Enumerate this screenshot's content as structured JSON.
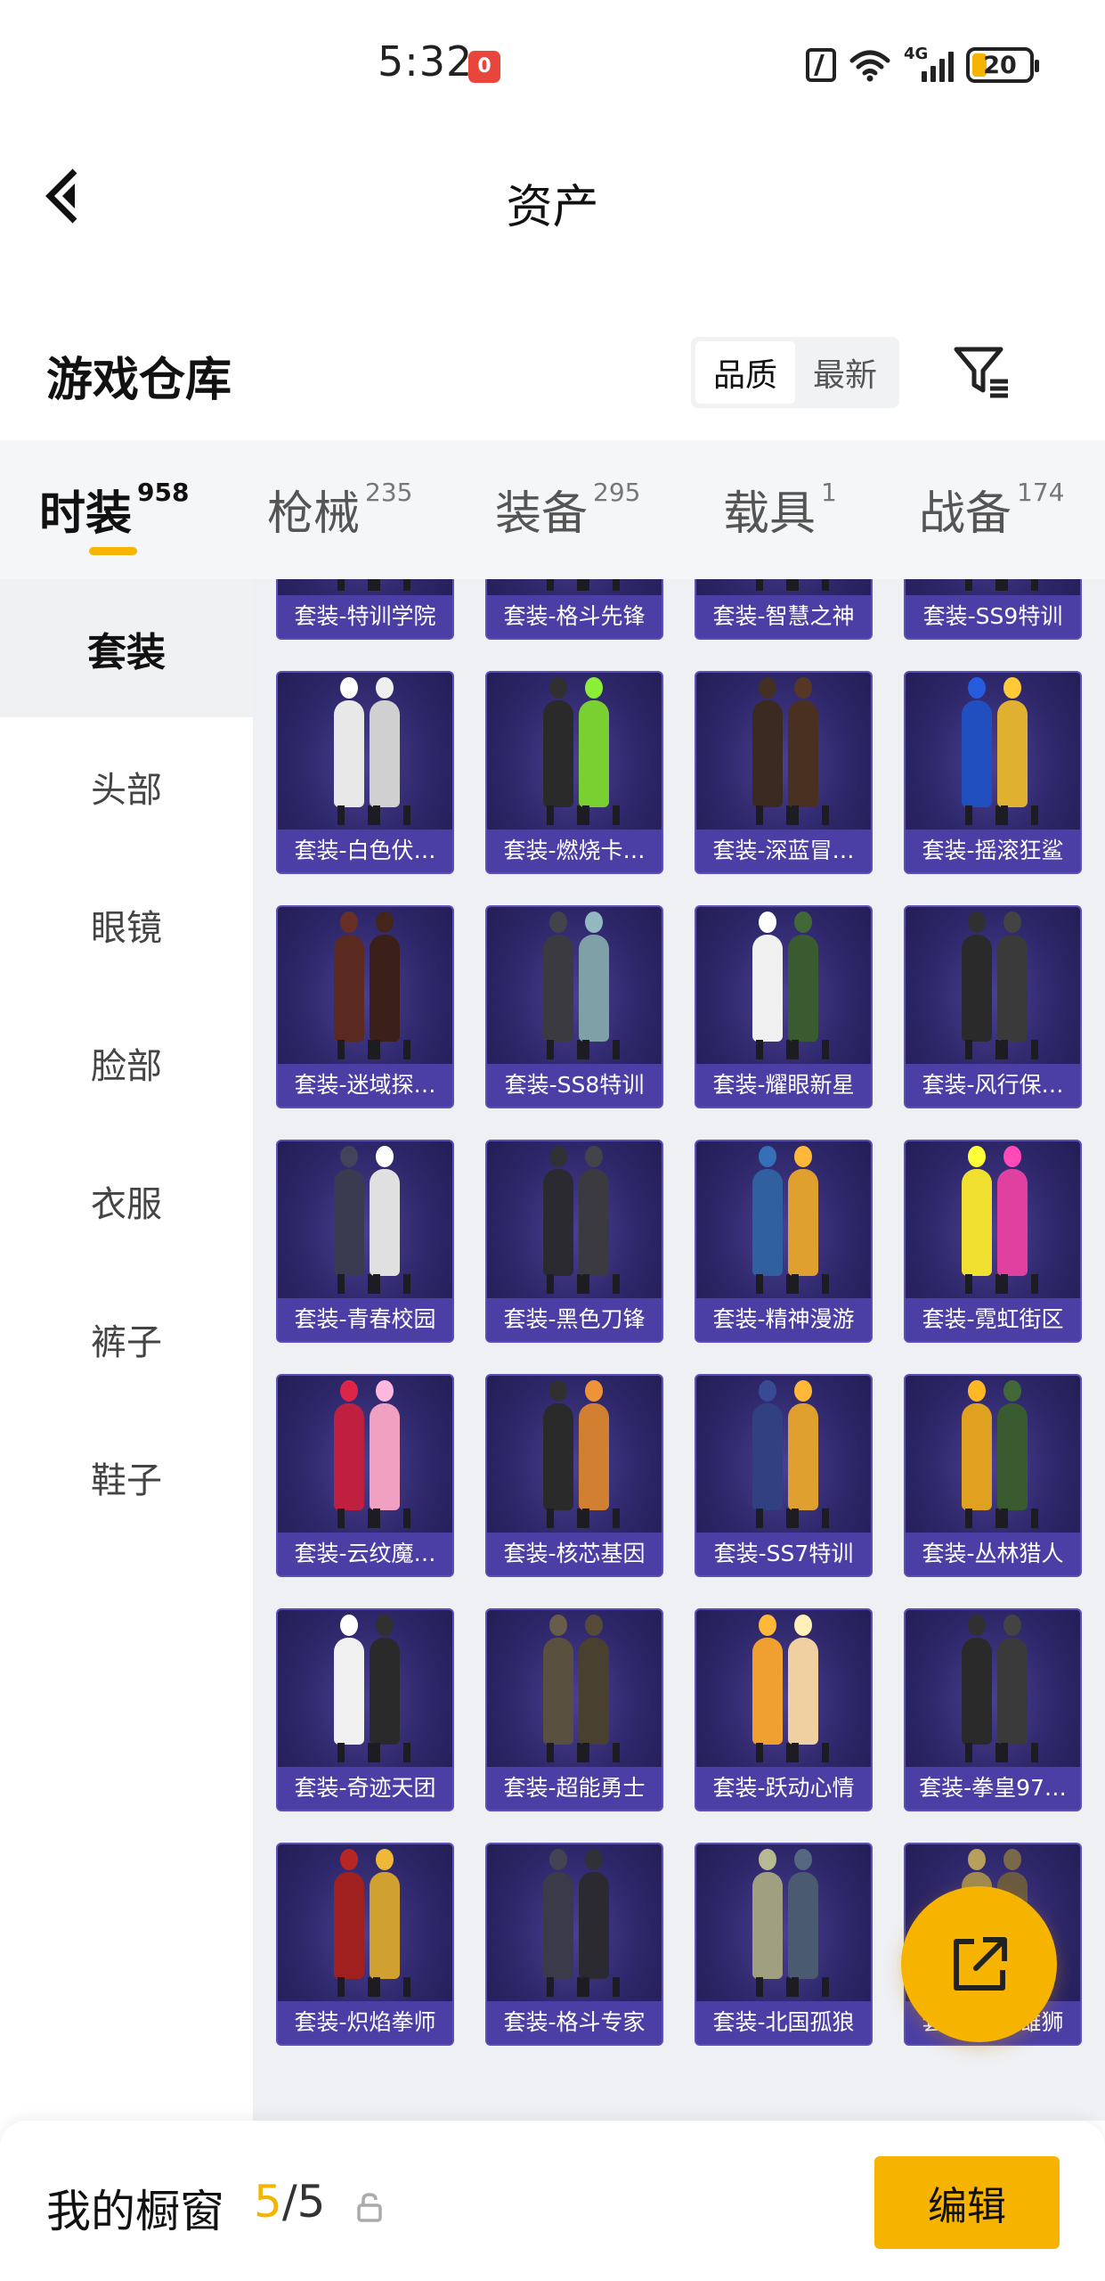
{
  "status_bar": {
    "time": "5:32",
    "notification_badge": "0",
    "network_label": "4G",
    "battery_level": "20",
    "icons": [
      "nfc-icon",
      "wifi-icon",
      "signal-icon",
      "battery-icon"
    ]
  },
  "header": {
    "title": "资产",
    "back_icon": "chevron-left-icon"
  },
  "warehouse": {
    "title": "游戏仓库",
    "sort_options": [
      {
        "label": "品质",
        "active": true
      },
      {
        "label": "最新",
        "active": false
      }
    ],
    "filter_icon": "filter-list-icon"
  },
  "category_tabs": [
    {
      "label": "时装",
      "count": "958",
      "active": true
    },
    {
      "label": "枪械",
      "count": "235",
      "active": false
    },
    {
      "label": "装备",
      "count": "295",
      "active": false
    },
    {
      "label": "载具",
      "count": "1",
      "active": false
    },
    {
      "label": "战备",
      "count": "174",
      "active": false
    }
  ],
  "sidebar": {
    "items": [
      {
        "label": "套装",
        "active": true
      },
      {
        "label": "头部",
        "active": false
      },
      {
        "label": "眼镜",
        "active": false
      },
      {
        "label": "脸部",
        "active": false
      },
      {
        "label": "衣服",
        "active": false
      },
      {
        "label": "裤子",
        "active": false
      },
      {
        "label": "鞋子",
        "active": false
      }
    ]
  },
  "items": [
    {
      "name": "套装-特训学院",
      "colors": [
        "#7a2f2f",
        "#e8e8e8"
      ]
    },
    {
      "name": "套装-格斗先锋",
      "colors": [
        "#3a3a3a",
        "#5a4a3a"
      ]
    },
    {
      "name": "套装-智慧之神",
      "colors": [
        "#7a2050",
        "#c0a030"
      ]
    },
    {
      "name": "套装-SS9特训",
      "colors": [
        "#7a3030",
        "#4a5a80"
      ]
    },
    {
      "name": "套装-白色伏…",
      "colors": [
        "#e8e8e8",
        "#d0d0d0"
      ]
    },
    {
      "name": "套装-燃烧卡…",
      "colors": [
        "#2a2a2a",
        "#7ad030"
      ]
    },
    {
      "name": "套装-深蓝冒…",
      "colors": [
        "#3a2a20",
        "#4a3020"
      ]
    },
    {
      "name": "套装-摇滚狂鲨",
      "colors": [
        "#2050c0",
        "#e0b030"
      ]
    },
    {
      "name": "套装-迷域探…",
      "colors": [
        "#5a2a20",
        "#3a2018"
      ]
    },
    {
      "name": "套装-SS8特训",
      "colors": [
        "#3a3a40",
        "#80a0a8"
      ]
    },
    {
      "name": "套装-耀眼新星",
      "colors": [
        "#f0f0f0",
        "#3a5a30"
      ]
    },
    {
      "name": "套装-风行保…",
      "colors": [
        "#2a2a2a",
        "#3a3a3a"
      ]
    },
    {
      "name": "套装-青春校园",
      "colors": [
        "#3a3a50",
        "#e0e0e0"
      ]
    },
    {
      "name": "套装-黑色刀锋",
      "colors": [
        "#2a2a30",
        "#3a3a40"
      ]
    },
    {
      "name": "套装-精神漫游",
      "colors": [
        "#3060a0",
        "#e0a030"
      ]
    },
    {
      "name": "套装-霓虹街区",
      "colors": [
        "#f0e030",
        "#e040a0"
      ]
    },
    {
      "name": "套装-云纹魔…",
      "colors": [
        "#c02040",
        "#f0a0c0"
      ]
    },
    {
      "name": "套装-核芯基因",
      "colors": [
        "#2a2a2a",
        "#d08030"
      ]
    },
    {
      "name": "套装-SS7特训",
      "colors": [
        "#304080",
        "#e0a030"
      ]
    },
    {
      "name": "套装-丛林猎人",
      "colors": [
        "#e0a020",
        "#3a5a30"
      ]
    },
    {
      "name": "套装-奇迹天团",
      "colors": [
        "#f0f0f0",
        "#2a2a2a"
      ]
    },
    {
      "name": "套装-超能勇士",
      "colors": [
        "#5a5040",
        "#4a4030"
      ]
    },
    {
      "name": "套装-跃动心情",
      "colors": [
        "#f0a030",
        "#f0d0a0"
      ]
    },
    {
      "name": "套装-拳皇97…",
      "colors": [
        "#2a2a2a",
        "#3a3a3a"
      ]
    },
    {
      "name": "套装-炽焰拳师",
      "colors": [
        "#a02020",
        "#d0a030"
      ]
    },
    {
      "name": "套装-格斗专家",
      "colors": [
        "#3a3a48",
        "#2a2a30"
      ]
    },
    {
      "name": "套装-北国孤狼",
      "colors": [
        "#a0a080",
        "#4a5a70"
      ]
    },
    {
      "name": "套装-沙漠雄狮",
      "colors": [
        "#a08a50",
        "#6a5a40"
      ]
    }
  ],
  "fab": {
    "icon": "share-external-icon"
  },
  "bottom_bar": {
    "label": "我的橱窗",
    "count_current": "5",
    "count_sep": "/",
    "count_total": "5",
    "lock_icon": "lock-icon",
    "edit_label": "编辑"
  },
  "accent_color": "#f6b300"
}
